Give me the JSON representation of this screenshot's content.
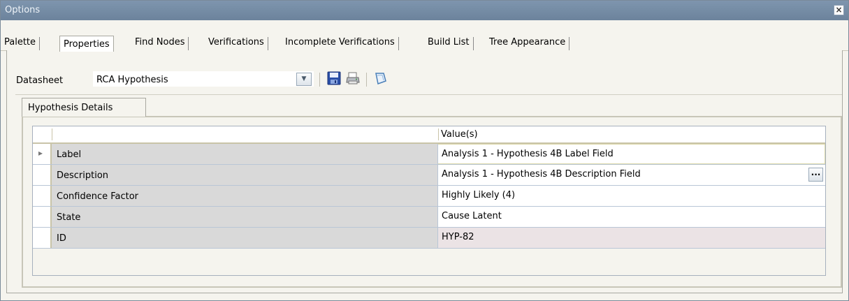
{
  "window": {
    "title": "Options",
    "close_glyph": "×"
  },
  "tabs": [
    {
      "label": "Palette"
    },
    {
      "label": "Properties"
    },
    {
      "label": "Find Nodes"
    },
    {
      "label": "Verifications"
    },
    {
      "label": "Incomplete Verifications"
    },
    {
      "label": "Build List"
    },
    {
      "label": "Tree Appearance"
    }
  ],
  "datasheet": {
    "label": "Datasheet",
    "value": "RCA Hypothesis",
    "dropdown_glyph": "▼",
    "tools": [
      "save-icon",
      "print-icon",
      "shape-icon"
    ]
  },
  "subtab": {
    "label": "Hypothesis Details"
  },
  "grid": {
    "columns": [
      "",
      "Value(s)"
    ],
    "rows": [
      {
        "name": "Label",
        "value": "Analysis 1 - Hypothesis 4B Label Field",
        "current": true
      },
      {
        "name": "Description",
        "value": "Analysis 1 - Hypothesis 4B  Description Field",
        "has_button": true
      },
      {
        "name": "Confidence Factor",
        "value": "Highly Likely (4)"
      },
      {
        "name": "State",
        "value": "Cause Latent"
      },
      {
        "name": "ID",
        "value": "HYP-82",
        "readonly": true
      }
    ],
    "row_indicator_glyph": "▸",
    "ellipsis_glyph": "..."
  },
  "colors": {
    "titlebar": "#728aa3",
    "readonly_cell": "#ebe3e5",
    "name_cell": "#d9d9d9",
    "current_row_border": "#dcd8a8"
  }
}
